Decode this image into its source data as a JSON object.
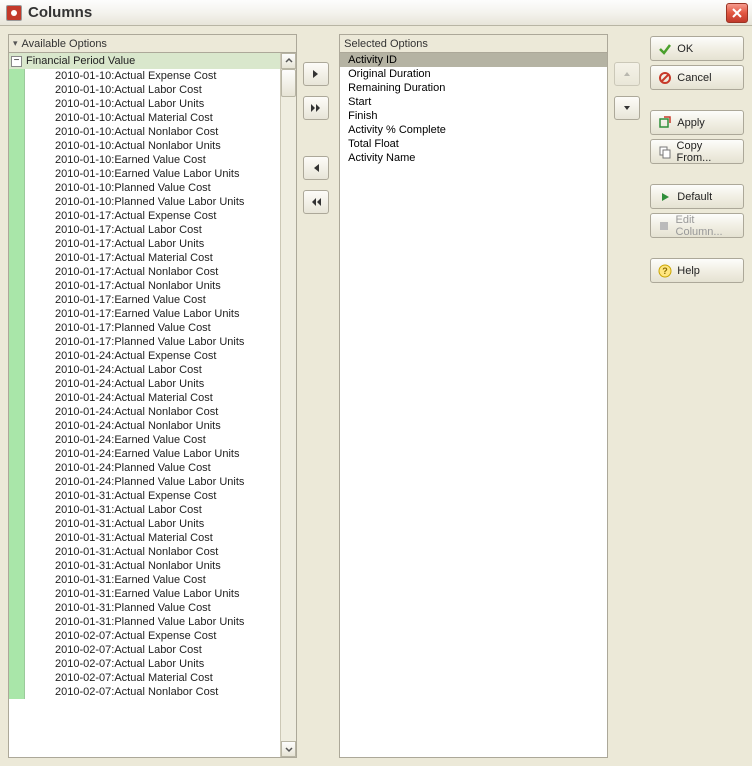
{
  "window": {
    "title": "Columns"
  },
  "available": {
    "header": "Available Options",
    "group": "Financial Period Value",
    "items": [
      "2010-01-10:Actual Expense Cost",
      "2010-01-10:Actual Labor Cost",
      "2010-01-10:Actual Labor Units",
      "2010-01-10:Actual Material Cost",
      "2010-01-10:Actual Nonlabor Cost",
      "2010-01-10:Actual Nonlabor Units",
      "2010-01-10:Earned Value Cost",
      "2010-01-10:Earned Value Labor Units",
      "2010-01-10:Planned Value Cost",
      "2010-01-10:Planned Value Labor Units",
      "2010-01-17:Actual Expense Cost",
      "2010-01-17:Actual Labor Cost",
      "2010-01-17:Actual Labor Units",
      "2010-01-17:Actual Material Cost",
      "2010-01-17:Actual Nonlabor Cost",
      "2010-01-17:Actual Nonlabor Units",
      "2010-01-17:Earned Value Cost",
      "2010-01-17:Earned Value Labor Units",
      "2010-01-17:Planned Value Cost",
      "2010-01-17:Planned Value Labor Units",
      "2010-01-24:Actual Expense Cost",
      "2010-01-24:Actual Labor Cost",
      "2010-01-24:Actual Labor Units",
      "2010-01-24:Actual Material Cost",
      "2010-01-24:Actual Nonlabor Cost",
      "2010-01-24:Actual Nonlabor Units",
      "2010-01-24:Earned Value Cost",
      "2010-01-24:Earned Value Labor Units",
      "2010-01-24:Planned Value Cost",
      "2010-01-24:Planned Value Labor Units",
      "2010-01-31:Actual Expense Cost",
      "2010-01-31:Actual Labor Cost",
      "2010-01-31:Actual Labor Units",
      "2010-01-31:Actual Material Cost",
      "2010-01-31:Actual Nonlabor Cost",
      "2010-01-31:Actual Nonlabor Units",
      "2010-01-31:Earned Value Cost",
      "2010-01-31:Earned Value Labor Units",
      "2010-01-31:Planned Value Cost",
      "2010-01-31:Planned Value Labor Units",
      "2010-02-07:Actual Expense Cost",
      "2010-02-07:Actual Labor Cost",
      "2010-02-07:Actual Labor Units",
      "2010-02-07:Actual Material Cost",
      "2010-02-07:Actual Nonlabor Cost"
    ]
  },
  "selected": {
    "header": "Selected Options",
    "items": [
      "Activity ID",
      "Original Duration",
      "Remaining Duration",
      "Start",
      "Finish",
      "Activity % Complete",
      "Total Float",
      "Activity Name"
    ],
    "selected_index": 0
  },
  "actions": {
    "ok": "OK",
    "cancel": "Cancel",
    "apply": "Apply",
    "copy_from": "Copy From...",
    "default": "Default",
    "edit_column": "Edit Column...",
    "help": "Help"
  },
  "icons": {
    "ok_color": "#4aa02c",
    "cancel_color": "#c73a2a",
    "apply_color": "#2f8f3a",
    "default_color": "#2f8f3a",
    "help_color": "#e6b800"
  }
}
